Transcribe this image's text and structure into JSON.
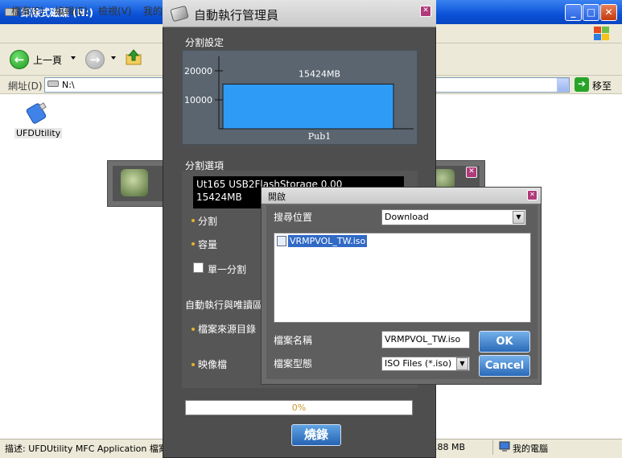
{
  "explorer": {
    "title": "卸除式磁碟 (N:)",
    "window_buttons": {
      "minimize": "_",
      "maximize": "□",
      "close": "✕"
    },
    "menu": [
      "檔案(F)",
      "編輯(E)",
      "檢視(V)",
      "我的"
    ],
    "toolbar": {
      "back_label": "上一頁"
    },
    "address": {
      "label": "網址(D)",
      "value": "N:\\",
      "go_label": "移至"
    },
    "files": [
      {
        "name": "UFDUtility",
        "icon": "usb-drive-icon"
      }
    ],
    "status": {
      "description": "描述: UFDUtility MFC Application 檔案",
      "size": ".88 MB",
      "location": "我的電腦"
    }
  },
  "autorun": {
    "title": "自動執行管理員",
    "partition_settings_label": "分割設定",
    "partition_options_label": "分割選項",
    "device_line1": "Ut165   USB2FlashStorage 0.00",
    "device_line2": "15424MB",
    "options": [
      "分割",
      "容量"
    ],
    "single_partition_label": "單一分割",
    "autorun_readonly_label": "自動執行與唯讀區",
    "source_dir_label": "檔案來源目錄",
    "image_file_label": "映像檔",
    "progress_text": "0%",
    "burn_label": "燒錄",
    "close_glyph": "✕"
  },
  "chart_data": {
    "type": "bar",
    "categories": [
      "Pub1"
    ],
    "values": [
      15424
    ],
    "data_labels": [
      "15424MB"
    ],
    "ylim": [
      0,
      25000
    ],
    "yticks": [
      10000,
      20000
    ],
    "ytick_labels": [
      "10000",
      "20000"
    ],
    "colors": {
      "bar": "#2e9cf6",
      "bar_border": "#1a1a1a"
    }
  },
  "open_dialog": {
    "title": "開啟",
    "look_in_label": "搜尋位置",
    "look_in_value": "Download",
    "files": [
      "VRMPVOL_TW.iso"
    ],
    "filename_label": "檔案名稱",
    "filename_value": "VRMPVOL_TW.iso",
    "filetype_label": "檔案型態",
    "filetype_value": "ISO Files (*.iso)",
    "ok_label": "OK",
    "cancel_label": "Cancel",
    "close_glyph": "✕",
    "dropdown_glyph": "▼"
  },
  "colors": {
    "xp_blue": "#0a52d8",
    "dark_panel": "#4e4e4e",
    "accent_orange": "#e8b030",
    "button_blue": "#2b6ab8"
  }
}
